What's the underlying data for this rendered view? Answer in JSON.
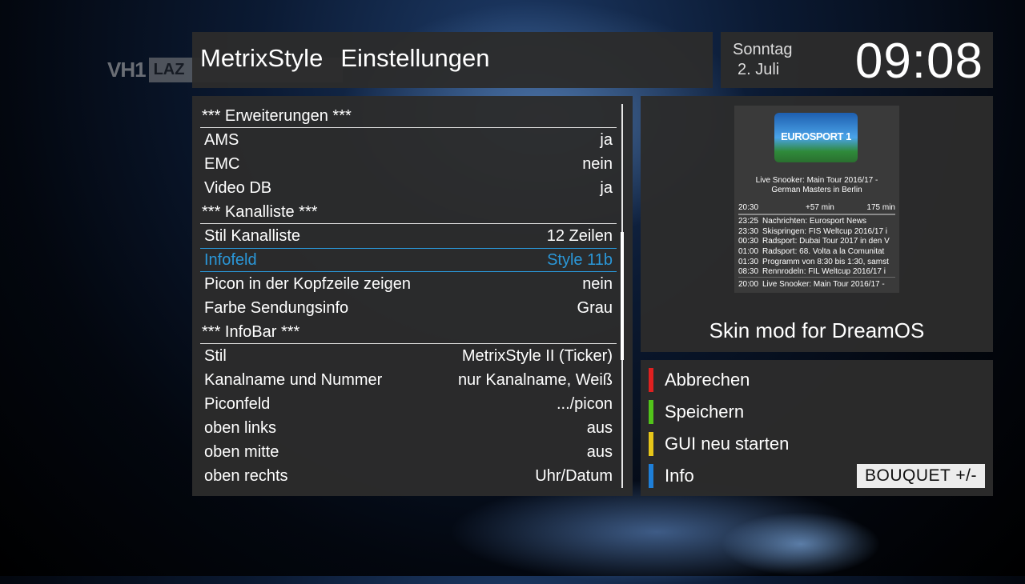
{
  "header": {
    "title_app": "MetrixStyle",
    "title_page": "Einstellungen"
  },
  "clock": {
    "day": "Sonntag",
    "date": "2. Juli",
    "time": "09:08"
  },
  "settings": {
    "rows": [
      {
        "type": "section",
        "label": "*** Erweiterungen ***",
        "value": ""
      },
      {
        "type": "item",
        "label": "AMS",
        "value": "ja"
      },
      {
        "type": "item",
        "label": "EMC",
        "value": "nein"
      },
      {
        "type": "item",
        "label": "Video DB",
        "value": "ja"
      },
      {
        "type": "section",
        "label": "*** Kanalliste ***",
        "value": ""
      },
      {
        "type": "item",
        "label": "Stil Kanalliste",
        "value": "12 Zeilen"
      },
      {
        "type": "selected",
        "label": "Infofeld",
        "value": "Style 11b"
      },
      {
        "type": "item",
        "label": "Picon in der Kopfzeile zeigen",
        "value": "nein"
      },
      {
        "type": "item",
        "label": "Farbe Sendungsinfo",
        "value": "Grau"
      },
      {
        "type": "section",
        "label": "*** InfoBar ***",
        "value": ""
      },
      {
        "type": "item",
        "label": "Stil",
        "value": "MetrixStyle II (Ticker)"
      },
      {
        "type": "item",
        "label": "Kanalname und Nummer",
        "value": "nur Kanalname, Weiß"
      },
      {
        "type": "item",
        "label": "Piconfeld",
        "value": ".../picon"
      },
      {
        "type": "item",
        "label": "oben links",
        "value": "aus"
      },
      {
        "type": "item",
        "label": "oben mitte",
        "value": "aus"
      },
      {
        "type": "item",
        "label": "oben rechts",
        "value": "Uhr/Datum"
      }
    ]
  },
  "preview": {
    "channel_logo_text": "EUROSPORT 1",
    "program_title_line1": "Live Snooker: Main Tour 2016/17 -",
    "program_title_line2": "German Masters in Berlin",
    "start_time": "20:30",
    "remaining": "+57 min",
    "duration": "175 min",
    "epg": [
      {
        "time": "23:25",
        "title": "Nachrichten: Eurosport News"
      },
      {
        "time": "23:30",
        "title": "Skispringen: FIS Weltcup 2016/17 i"
      },
      {
        "time": "00:30",
        "title": "Radsport: Dubai Tour 2017 in den V"
      },
      {
        "time": "01:00",
        "title": "Radsport: 68. Volta a la Comunitat"
      },
      {
        "time": "01:30",
        "title": "Programm von 8:30 bis 1:30, samst"
      },
      {
        "time": "08:30",
        "title": "Rennrodeln: FIL Weltcup 2016/17 i"
      }
    ],
    "now": {
      "time": "20:00",
      "title": "Live Snooker: Main Tour 2016/17 -"
    },
    "caption": "Skin mod for DreamOS"
  },
  "buttons": {
    "red": "Abbrechen",
    "green": "Speichern",
    "yellow": "GUI neu starten",
    "blue": "Info",
    "bouquet": "BOUQUET +/-"
  },
  "background_logo": {
    "part1": "VH1",
    "part2": "LAZ"
  },
  "colors": {
    "selection": "#2a97d8",
    "red": "#e02020",
    "green": "#52c41a",
    "yellow": "#e6c619",
    "blue": "#1e7fd8"
  }
}
